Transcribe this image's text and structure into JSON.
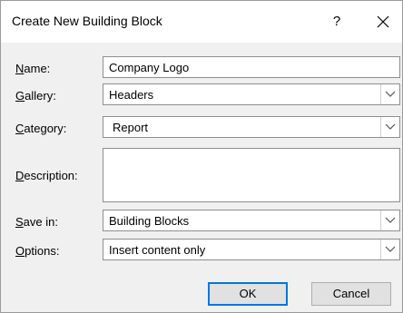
{
  "dialog": {
    "title": "Create New Building Block",
    "help_label": "?"
  },
  "fields": {
    "name": {
      "label_key": "N",
      "label_rest": "ame:",
      "value": "Company Logo"
    },
    "gallery": {
      "label_key": "G",
      "label_rest": "allery:",
      "value": "Headers"
    },
    "category": {
      "label_key": "C",
      "label_rest": "ategory:",
      "value": "Report"
    },
    "description": {
      "label_key": "D",
      "label_rest": "escription:",
      "value": ""
    },
    "save_in": {
      "label_key": "S",
      "label_rest": "ave in:",
      "value": "Building Blocks"
    },
    "options": {
      "label_key": "O",
      "label_rest": "ptions:",
      "value": "Insert content only"
    }
  },
  "buttons": {
    "ok": "OK",
    "cancel": "Cancel"
  },
  "icons": {
    "close": "close-icon",
    "dropdown": "chevron-down-icon"
  },
  "colors": {
    "focus_border": "#0078d7",
    "dialog_bg": "#f0f0f0"
  }
}
